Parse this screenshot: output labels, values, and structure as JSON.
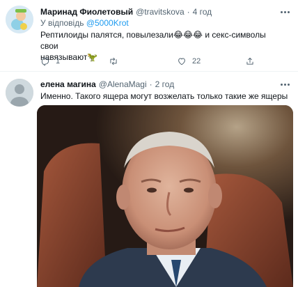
{
  "tweet1": {
    "author_name": "Маринад Фиолетовый",
    "author_handle": "@travitskova",
    "separator": "·",
    "time": "4 год",
    "reply_prefix": "У відповідь",
    "reply_mention": "@5000Krot",
    "text_line1": "Рептилоиды палятся, повылезали😂😂😂 и секс-символы свои",
    "text_line2": "навязывают🦖",
    "reply_count": "1",
    "retweet_count": "",
    "like_count": "22"
  },
  "tweet2": {
    "author_name": "елена магина",
    "author_handle": "@AlenaMagi",
    "separator": "·",
    "time": "2 год",
    "text": "Именно. Такого ящера могут возжелать только такие же ящеры"
  },
  "colors": {
    "secondary_text": "#536471",
    "link": "#1d9bf0",
    "divider": "#eff3f4"
  },
  "icons": [
    "more-icon",
    "reply-icon",
    "retweet-icon",
    "like-icon",
    "share-icon"
  ]
}
